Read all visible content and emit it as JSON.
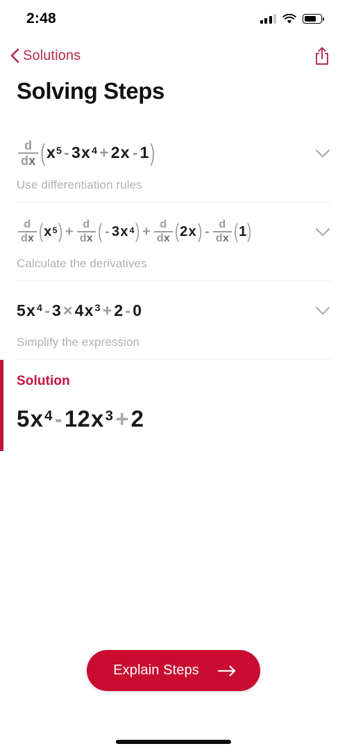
{
  "status_bar": {
    "time": "2:48",
    "signal_icon": "cellular-signal-icon",
    "wifi_icon": "wifi-icon",
    "battery_icon": "battery-icon",
    "battery_level": "70%"
  },
  "nav": {
    "back_label": "Solutions",
    "back_icon": "chevron-left-icon",
    "share_icon": "share-icon",
    "accent_color": "#b4284b"
  },
  "header": {
    "title": "Solving Steps"
  },
  "steps": [
    {
      "equation_text": "d/dx (x^5 - 3x^4 + 2x - 1)",
      "caption": "Use differentiation rules",
      "expand_icon": "chevron-down-icon"
    },
    {
      "equation_text": "d/dx (x^5) + d/dx (-3x^4) + d/dx (2x) - d/dx (1)",
      "caption": "Calculate the derivatives",
      "expand_icon": "chevron-down-icon"
    },
    {
      "equation_text": "5x^4 - 3 × 4x^3 + 2 - 0",
      "caption": "Simplify the expression",
      "expand_icon": "chevron-down-icon"
    }
  ],
  "solution": {
    "label": "Solution",
    "equation_text": "5x^4 - 12x^3 + 2",
    "accent_color": "#c4133c"
  },
  "cta": {
    "label": "Explain Steps",
    "arrow_icon": "arrow-right-icon",
    "background_color": "#c90c30"
  },
  "math_tokens": {
    "d": "d",
    "dx_d": "d",
    "dx_x": "x",
    "lparen": "(",
    "rparen": ")",
    "x": "x",
    "exp5": "5",
    "exp4": "4",
    "exp3": "3",
    "minus": "-",
    "plus": "+",
    "times": "×",
    "n1": "1",
    "n2": "2",
    "n3": "3",
    "n4": "4",
    "n5": "5",
    "n0": "0",
    "n12": "12"
  }
}
